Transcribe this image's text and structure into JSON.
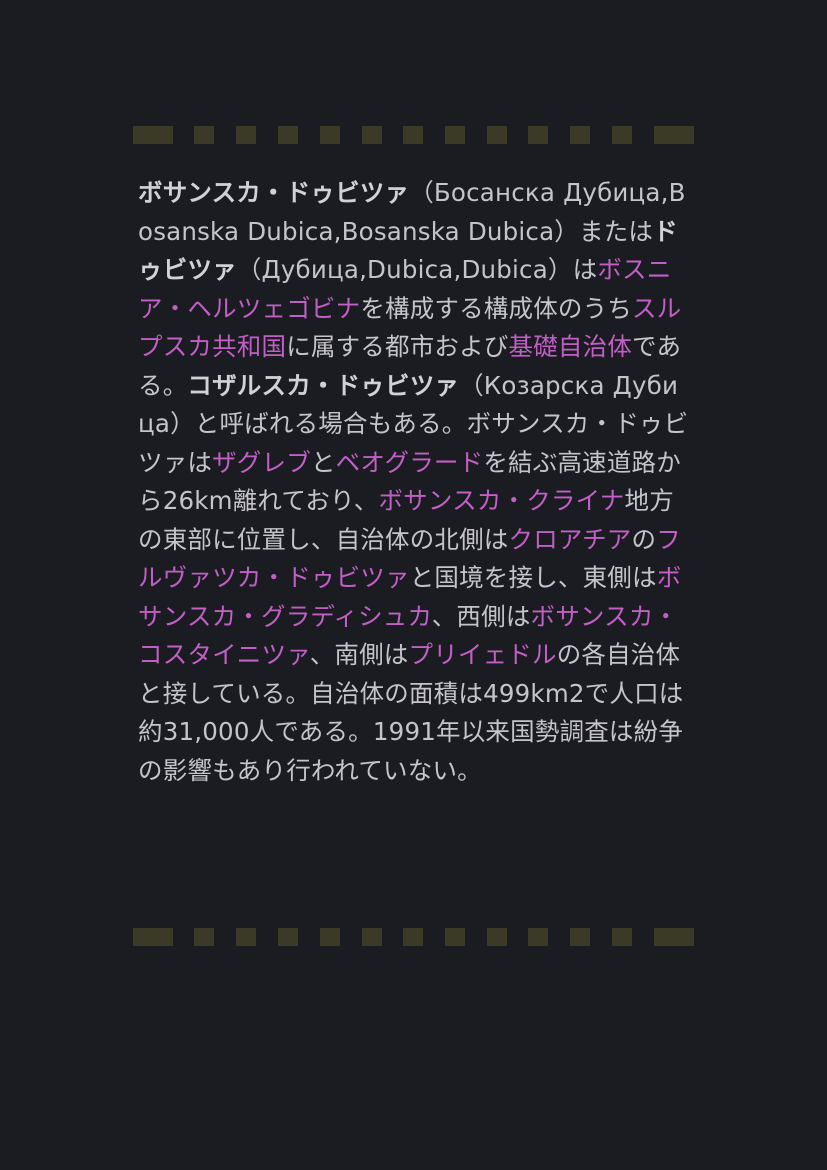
{
  "article": {
    "t1": "ボサンスカ・ドゥビツァ",
    "t2": "（Босанска Дубица,Bosanska Dubica,Bosanska Dubica）または",
    "t3": "ドゥビツァ",
    "t4": "（Дубица,Dubica,Dubica）は",
    "l_bih": "ボスニア・ヘルツェゴビナ",
    "t5": "を構成する構成体のうち",
    "l_rs": "スルプスカ共和国",
    "t6": "に属する都市および",
    "l_municipality": "基礎自治体",
    "t7": "である。",
    "t8": "コザルスカ・ドゥビツァ",
    "t9": "（Козарска Дубица）と呼ばれる場合もある。ボサンスカ・ドゥビツァは",
    "l_zagreb": "ザグレブ",
    "t10": "と",
    "l_belgrade": "ベオグラード",
    "t11": "を結ぶ高速道路から26km離れており、",
    "l_krajina": "ボサンスカ・クライナ",
    "t12": "地方の東部に位置し、自治体の北側は",
    "l_croatia": "クロアチア",
    "t13": "の",
    "l_hrvatska_dubica": "フルヴァツカ・ドゥビツァ",
    "t14": "と国境を接し、東側は",
    "l_gradiska": "ボサンスカ・グラディシュカ",
    "t15": "、西側は",
    "l_kostajnica": "ボサンスカ・コスタイニツァ",
    "t16": "、南側は",
    "l_prijedor": "プリイェドル",
    "t17": "の各自治体と接している。自治体の面積は499km2で人口は約31,000人である。1991年以来国勢調査は紛争の影響もあり行われていない。"
  },
  "colors": {
    "background": "#1b1c21",
    "text": "#c4c4c9",
    "link": "#c15fc6",
    "divider": "#3a3a26"
  }
}
